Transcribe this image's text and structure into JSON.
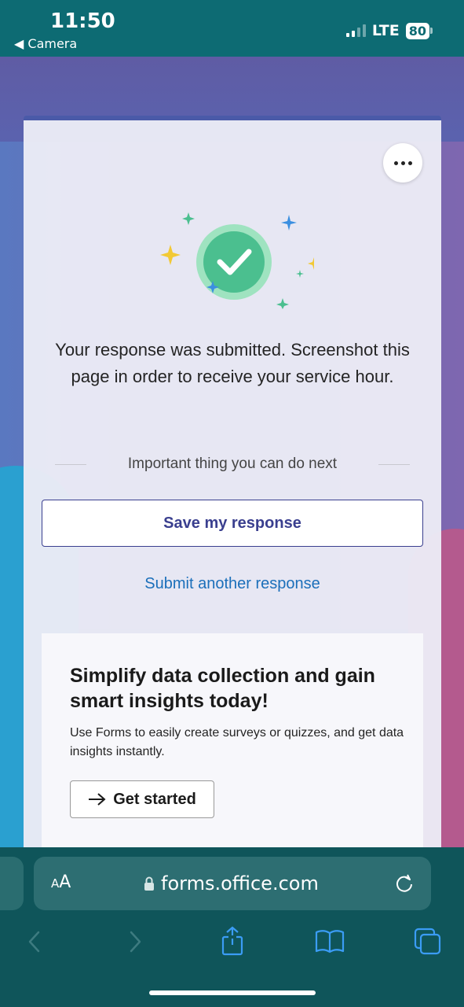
{
  "status_bar": {
    "time": "11:50",
    "back_label": "◀ Camera",
    "network": "LTE",
    "battery": "80"
  },
  "card": {
    "message": "Your response was submitted. Screenshot this page in order to receive your service hour.",
    "next_heading": "Important thing you can do next",
    "save_label": "Save my response",
    "submit_another_label": "Submit another response"
  },
  "promo": {
    "title": "Simplify data collection and gain smart insights today!",
    "text": "Use Forms to easily create surveys or quizzes, and get data insights instantly.",
    "button_label": "Get started"
  },
  "browser": {
    "aa_label_small": "A",
    "aa_label_large": "A",
    "url": "forms.office.com"
  },
  "colors": {
    "accent": "#3a3f8f",
    "link": "#1b6fba",
    "success": "#4bbf8f",
    "toolbar": "#0f555a"
  },
  "icons": [
    "more-icon",
    "checkmark-icon",
    "sparkle-icon",
    "arrow-right-icon",
    "lock-icon",
    "reload-icon",
    "back-icon",
    "forward-icon",
    "share-icon",
    "bookmarks-icon",
    "tabs-icon"
  ]
}
